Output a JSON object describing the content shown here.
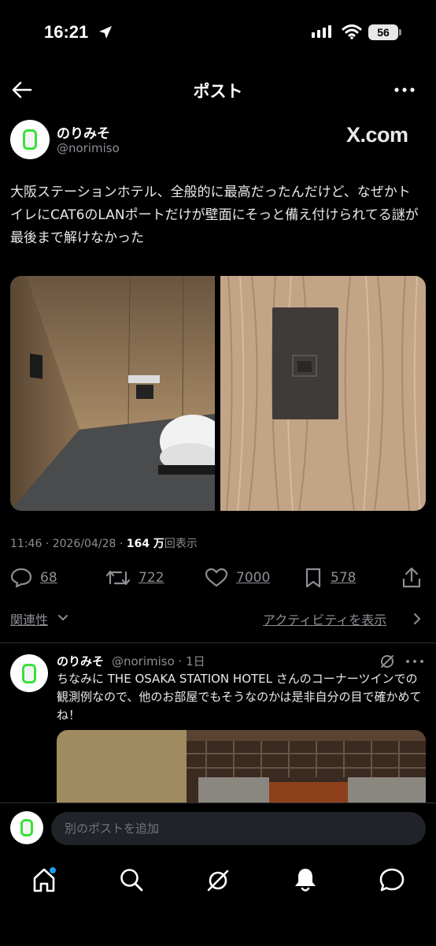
{
  "status_bar": {
    "time": "16:21",
    "battery": "56"
  },
  "nav": {
    "title": "ポスト"
  },
  "post": {
    "author_name": "のりみそ",
    "author_handle": "@norimiso",
    "source_badge": "X.com",
    "text": "大阪ステーションホテル、全般的に最高だったんだけど、なぜかトイレにCAT6のLANポートだけが壁面にそっと備え付けられてる謎が最後まで解けなかった",
    "time": "11:46 · 2026/04/28 · ",
    "views_count": "164 万",
    "views_label": "回表示",
    "replies": "68",
    "reposts": "722",
    "likes": "7000",
    "bookmarks": "578"
  },
  "sort": {
    "relevance_label": "関連性",
    "activity_label": "アクティビティを表示"
  },
  "reply": {
    "author_name": "のりみそ",
    "author_handle": "@norimiso · 1日",
    "text": "ちなみに THE OSAKA STATION HOTEL さんのコーナーツインでの観測例なので、他のお部屋でもそうなのかは是非自分の目で確かめてね！"
  },
  "composer": {
    "placeholder": "別のポストを追加"
  },
  "icons": {
    "back": "arrow-left-icon",
    "more": "more-dots-icon",
    "location": "location-arrow-icon",
    "wifi": "wifi-icon",
    "reply": "comment-icon",
    "repost": "repost-icon",
    "like": "heart-icon",
    "bookmark": "bookmark-icon",
    "share": "share-icon",
    "grok": "grok-icon",
    "home": "home-icon",
    "search": "search-icon",
    "notifications": "bell-icon",
    "messages": "message-icon",
    "chevron": "chevron-icon"
  },
  "colors": {
    "background": "#000000",
    "text": "#e7e9ea",
    "muted": "#8b8f94",
    "accent": "#1d9bf0"
  }
}
